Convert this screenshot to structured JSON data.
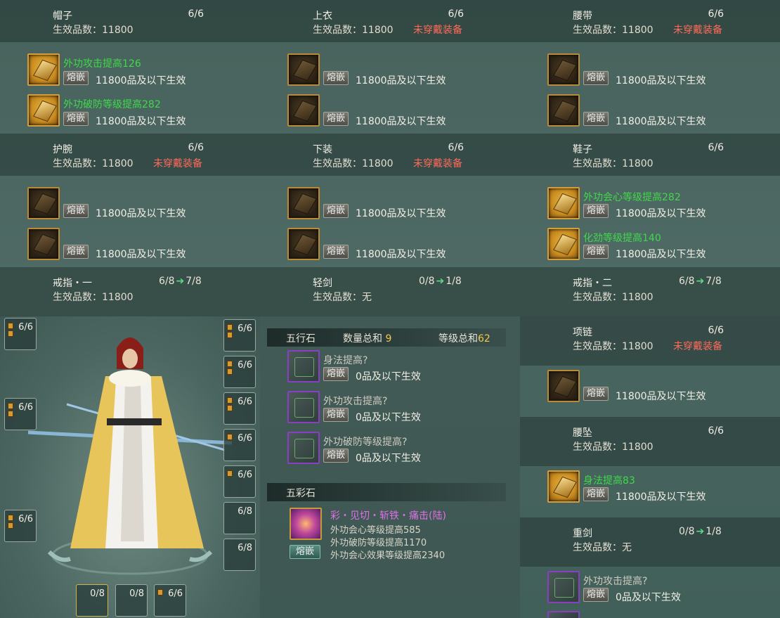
{
  "slots": {
    "hat": {
      "name": "帽子",
      "count": "6/6",
      "eff_label": "生效品数：11800",
      "worn_warning": ""
    },
    "top": {
      "name": "上衣",
      "count": "6/6",
      "eff_label": "生效品数：11800",
      "worn_warning": "未穿戴装备"
    },
    "belt": {
      "name": "腰带",
      "count": "6/6",
      "eff_label": "生效品数：11800",
      "worn_warning": "未穿戴装备"
    },
    "bracer": {
      "name": "护腕",
      "count": "6/6",
      "eff_label": "生效品数：11800",
      "worn_warning": "未穿戴装备"
    },
    "pants": {
      "name": "下装",
      "count": "6/6",
      "eff_label": "生效品数：11800",
      "worn_warning": "未穿戴装备"
    },
    "shoes": {
      "name": "鞋子",
      "count": "6/6",
      "eff_label": "生效品数：11800",
      "worn_warning": ""
    },
    "ring1": {
      "name": "戒指・一",
      "count": "6/8",
      "next": "7/8",
      "eff_label": "生效品数：11800"
    },
    "light_sword": {
      "name": "轻剑",
      "count": "0/8",
      "next": "1/8",
      "eff_label": "生效品数：无"
    },
    "ring2": {
      "name": "戒指・二",
      "count": "6/8",
      "next": "7/8",
      "eff_label": "生效品数：11800"
    },
    "necklace": {
      "name": "项链",
      "count": "6/6",
      "eff_label": "生效品数：11800",
      "worn_warning": "未穿戴装备"
    },
    "pendant": {
      "name": "腰坠",
      "count": "6/6",
      "eff_label": "生效品数：11800"
    },
    "heavy_sword": {
      "name": "重剑",
      "count": "0/8",
      "next": "1/8",
      "eff_label": "生效品数：无"
    }
  },
  "inlay": {
    "button_label": "熔嵌",
    "effect_text": "11800品及以下生效",
    "zero_effect_text": "0品及以下生效"
  },
  "gem_bonuses": {
    "hat_1": "外功攻击提高126",
    "hat_2": "外功破防等级提高282",
    "shoes_1": "外功会心等级提高282",
    "shoes_2": "化劲等级提高140",
    "pendant_1": "身法提高83"
  },
  "wuxing": {
    "title": "五行石",
    "count_label": "数量总和",
    "count_value": "9",
    "level_label": "等级总和",
    "level_value": "62",
    "items": [
      {
        "name": "身法提高?"
      },
      {
        "name": "外功攻击提高?"
      },
      {
        "name": "外功破防等级提高?"
      }
    ]
  },
  "wucai": {
    "title": "五彩石",
    "gem_name": "彩・见切・斩铁・痛击(陆)",
    "effects": [
      "外功会心等级提高585",
      "外功破防等级提高1170",
      "外功会心效果等级提高2340"
    ]
  },
  "heavy_sword_socket": {
    "name": "外功攻击提高?"
  },
  "char_slots": {
    "left": [
      "6/6",
      "6/6",
      "6/6"
    ],
    "right": [
      "6/6",
      "6/6",
      "6/6",
      "6/6",
      "6/6",
      "6/8",
      "6/8"
    ],
    "bottom": [
      "0/8",
      "0/8",
      "6/6"
    ]
  },
  "colors": {
    "bonus_green": "#3fd94a",
    "warning_red": "#ff6a5a",
    "gold": "#f2c94c",
    "purple_gem_name": "#e070e8"
  }
}
